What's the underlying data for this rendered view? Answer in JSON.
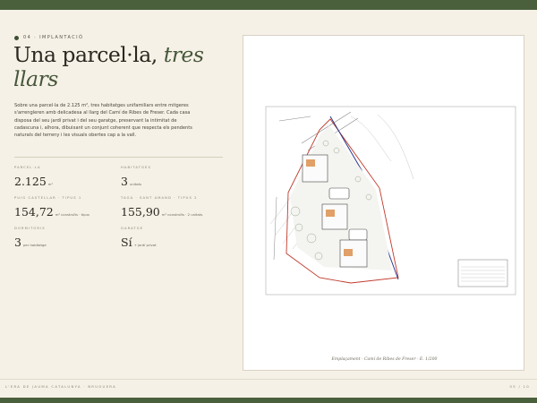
{
  "section": {
    "tag": "04 · IMPLANTACIÓ"
  },
  "headline": {
    "roman": "Una parcel·la,",
    "italic": "tres",
    "italic2": "llars"
  },
  "intro": "Sobre una parcel·la de 2.125 m², tres habitatges unifamiliars entre mitgeres s'arrengleren amb delicadesa al llarg del Camí de Ribes de Freser. Cada casa disposa del seu jardí privat i del seu garatge, preservant la intimitat de cadascuna i, alhora, dibuixant un conjunt coherent que respecta els pendents naturals del terreny i les visuals obertes cap a la vall.",
  "stats": [
    {
      "label": "PARCEL·LA",
      "value": "2.125",
      "unit": "m²"
    },
    {
      "label": "HABITATGES",
      "value": "3",
      "unit": "unitats"
    },
    {
      "label": "PUIG CASTELLAR · TIPUS 1",
      "value": "154,72",
      "unit": "m² construïts · tipus"
    },
    {
      "label": "TAGA · SANT AMAND · TIPUS 2",
      "value": "155,90",
      "unit": "m² construïts · 2 unitats"
    },
    {
      "label": "DORMITORIS",
      "value": "3",
      "unit": "per habitatge"
    },
    {
      "label": "GARATGE",
      "value": "Sí",
      "unit": "+ jardí privat"
    }
  ],
  "plan": {
    "caption": "Emplaçament · Camí de Ribes de Freser · E. 1/200"
  },
  "footer": {
    "left": "L'ERA DE JAUMA CATALUNYA · BRUGUERA",
    "right": "05 / 10"
  },
  "colors": {
    "accent": "#4a5f3c",
    "background": "#f5f1e6",
    "plot_red": "#c0392b",
    "plot_blue": "#2d3a8c"
  }
}
